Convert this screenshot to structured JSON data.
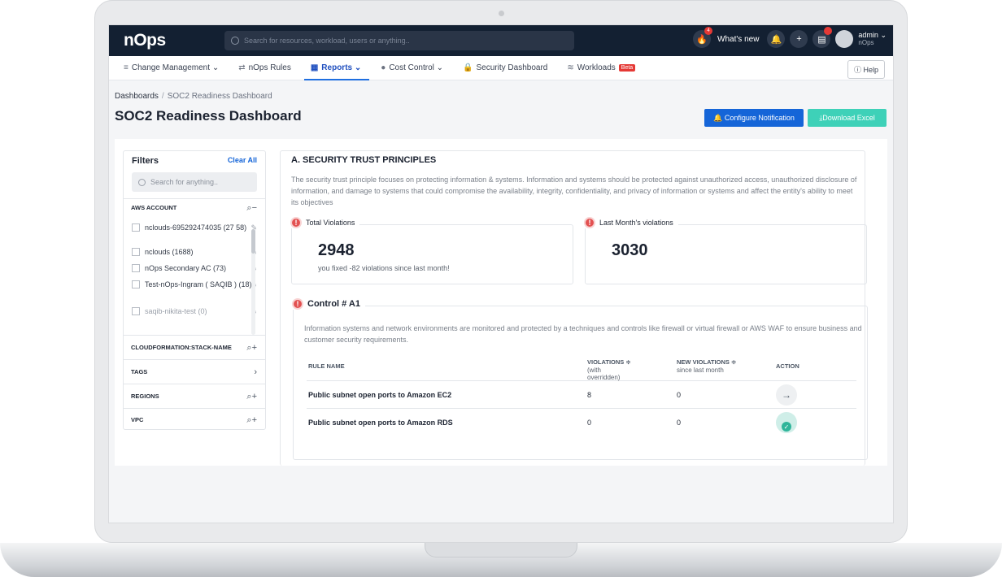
{
  "app": {
    "logo": "nOps",
    "search_placeholder": "Search for resources, workload, users or anything..",
    "whats_new": "What's new",
    "whats_new_count": "4",
    "user": "admin",
    "user_sub": "nOps"
  },
  "nav": {
    "items": [
      {
        "label": "Change Management",
        "icon": "stack-icon",
        "chev": "﹀"
      },
      {
        "label": "nOps Rules",
        "icon": "swap-icon",
        "chev": ""
      },
      {
        "label": "Reports",
        "icon": "report-icon",
        "chev": "﹀"
      },
      {
        "label": "Cost Control",
        "icon": "coin-icon",
        "chev": "﹀"
      },
      {
        "label": "Security Dashboard",
        "icon": "lock-icon",
        "chev": ""
      },
      {
        "label": "Workloads",
        "icon": "layers-icon",
        "chev": ""
      }
    ],
    "beta": "Beta",
    "help": "Help"
  },
  "page": {
    "crumb_root": "Dashboards",
    "crumb_current": "SOC2 Readiness Dashboard",
    "title": "SOC2 Readiness Dashboard",
    "configure": "Configure Notification",
    "download": "Download Excel"
  },
  "filters": {
    "title": "Filters",
    "clear": "Clear All",
    "search": "Search for anything..",
    "aws_account": "AWS ACCOUNT",
    "accounts": [
      "nclouds-695292474035 (27 58)",
      "nclouds (1688)",
      "nOps Secondary AC (73)",
      "Test-nOps-Ingram ( SAQIB ) (18)",
      "saqib-nikita-test (0)"
    ],
    "sections": [
      "CLOUDFORMATION:STACK-NAME",
      "TAGS",
      "REGIONS",
      "VPC"
    ]
  },
  "main": {
    "title": "A. SECURITY TRUST PRINCIPLES",
    "desc": "The security trust principle focuses on protecting information & systems. Information and systems should be protected against unauthorized access, unauthorized disclosure of information, and damage to systems that could compromise the availability, integrity, confidentiality, and privacy of information or systems and affect the entity's ability to meet its objectives",
    "total_label": "Total Violations",
    "total_value": "2948",
    "total_note": "you fixed -82 violations since last month!",
    "last_label": "Last Month's violations",
    "last_value": "3030",
    "control_title": "Control # A1",
    "control_desc": "Information systems and network environments are monitored and protected by a techniques and controls like firewall or virtual firewall or AWS WAF to ensure business and customer security requirements.",
    "headers": {
      "rule": "RULE NAME",
      "violations": "VIOLATIONS ≑",
      "violations_sub": "(with overridden)",
      "new": "NEW VIOLATIONS ≑",
      "new_sub": "since last month",
      "action": "ACTION"
    },
    "rows": [
      {
        "rule": "Public subnet open ports to Amazon EC2",
        "violations": "8",
        "new": "0"
      },
      {
        "rule": "Public subnet open ports to Amazon RDS",
        "violations": "0",
        "new": "0"
      }
    ]
  }
}
